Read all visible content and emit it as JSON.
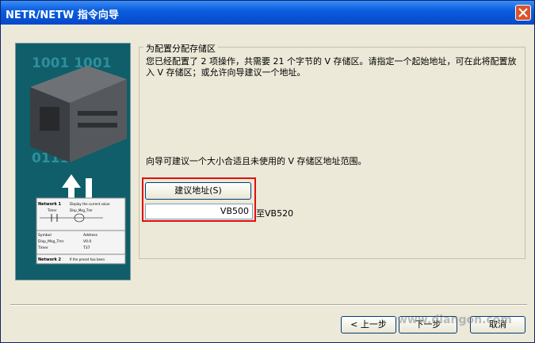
{
  "window": {
    "title": "NETR/NETW 指令向导"
  },
  "side_image": {
    "digits_top": "1001  1001",
    "digits_bottom": "0111",
    "network1": "Network 1",
    "network1_desc": "Display the current value",
    "contact_label": "Timer",
    "coil_label": "Disp_Msg_Tmr",
    "symbol_header": "Symbol",
    "address_header": "Address",
    "row1_symbol": "Disp_Msg_Tmr",
    "row1_address": "V0.0",
    "row2_symbol": "Timer",
    "row2_address": "T37",
    "network2": "Network 2",
    "network2_desc": "If the preset has been"
  },
  "group": {
    "title": "为配置分配存储区",
    "description": "您已经配置了 2 项操作，共需要 21 个字节的 V 存储区。请指定一个起始地址，可在此将配置放入 V 存储区；或允许向导建议一个地址。",
    "hint": "向导可建议一个大小合适且未使用的 V 存储区地址范围。",
    "suggest_button": "建议地址(S)",
    "address_value": "VB500",
    "range_end": "至VB520"
  },
  "footer": {
    "back_button": "< 上一步",
    "next_button": "下一步",
    "cancel_button": "取消"
  },
  "watermark": "www.diangon.com",
  "colors": {
    "titlebar": "#0548c8",
    "highlight": "#e01010",
    "face": "#ece9d8"
  }
}
